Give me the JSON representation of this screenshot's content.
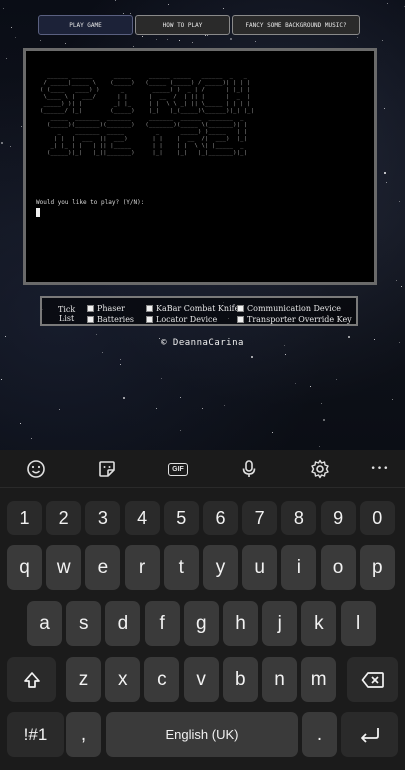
{
  "tabs": [
    {
      "label": "PLAY GAME"
    },
    {
      "label": "HOW TO PLAY"
    },
    {
      "label": "FANCY SOME BACKGROUND MUSIC?"
    }
  ],
  "terminal": {
    "prompt": "Would you like to play? (Y/N):"
  },
  "ticklist": {
    "label_line1": "Tick",
    "label_line2": "List",
    "items": [
      {
        "label": "Phaser"
      },
      {
        "label": "KaBar Combat Knife"
      },
      {
        "label": "Communication Device"
      },
      {
        "label": "Batteries"
      },
      {
        "label": "Locator Device"
      },
      {
        "label": "Transporter Override Key"
      }
    ]
  },
  "credit": "© DeannaCarina",
  "keyboard": {
    "toolbar": [
      "emoji-icon",
      "sticker-icon",
      "gif-icon",
      "mic-icon",
      "settings-icon",
      "more-icon"
    ],
    "gif_label": "GIF",
    "more_label": "•••",
    "row_numbers": [
      "1",
      "2",
      "3",
      "4",
      "5",
      "6",
      "7",
      "8",
      "9",
      "0"
    ],
    "row1": [
      "q",
      "w",
      "e",
      "r",
      "t",
      "y",
      "u",
      "i",
      "o",
      "p"
    ],
    "row2": [
      "a",
      "s",
      "d",
      "f",
      "g",
      "h",
      "j",
      "k",
      "l"
    ],
    "row3": [
      "z",
      "x",
      "c",
      "v",
      "b",
      "n",
      "m"
    ],
    "symbols": "!#1",
    "comma": ",",
    "space": "English (UK)",
    "period": "."
  }
}
